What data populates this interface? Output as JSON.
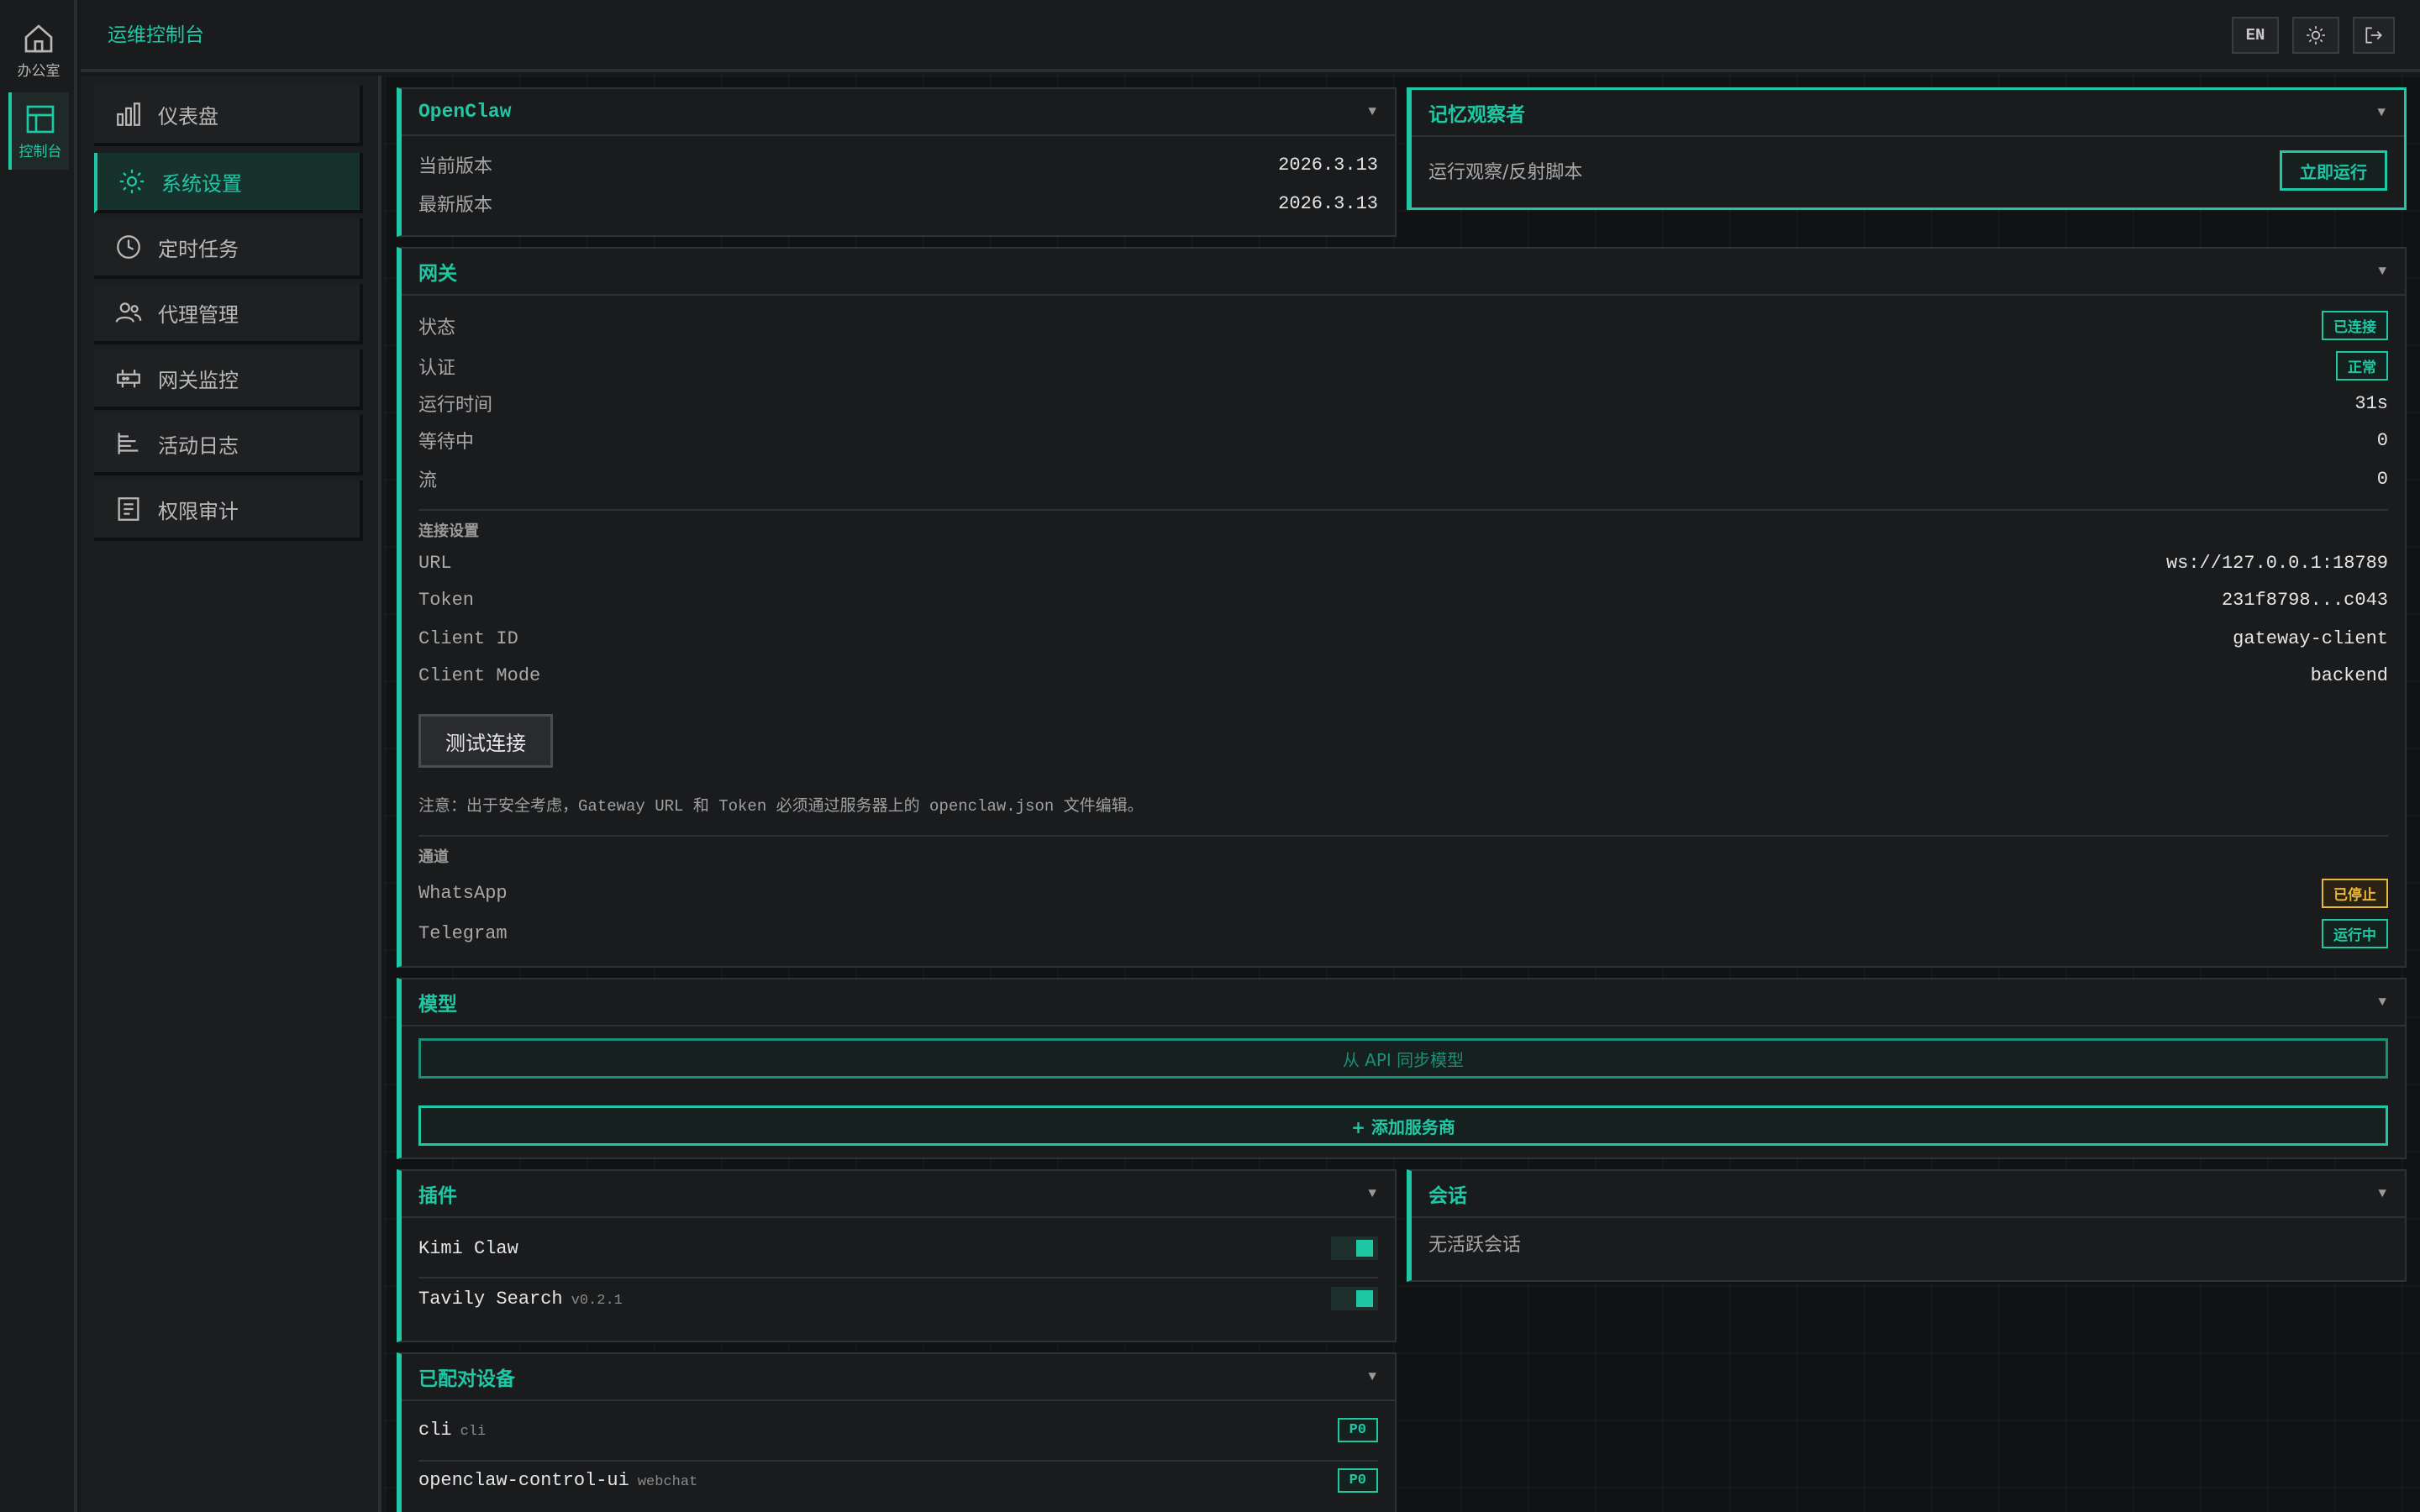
{
  "rail": {
    "office_label": "办公室",
    "console_label": "控制台"
  },
  "topbar": {
    "title": "运维控制台",
    "lang_label": "EN"
  },
  "nav": {
    "items": [
      {
        "label": "仪表盘",
        "icon": "bar-chart-icon"
      },
      {
        "label": "系统设置",
        "icon": "gear-icon",
        "active": true
      },
      {
        "label": "定时任务",
        "icon": "clock-icon"
      },
      {
        "label": "代理管理",
        "icon": "users-icon"
      },
      {
        "label": "网关监控",
        "icon": "router-icon"
      },
      {
        "label": "活动日志",
        "icon": "list-icon"
      },
      {
        "label": "权限审计",
        "icon": "document-icon"
      }
    ]
  },
  "openclaw": {
    "title": "OpenClaw",
    "current_version_label": "当前版本",
    "current_version": "2026.3.13",
    "latest_version_label": "最新版本",
    "latest_version": "2026.3.13"
  },
  "memory": {
    "title": "记忆观察者",
    "script_label": "运行观察/反射脚本",
    "run_button": "立即运行"
  },
  "gateway": {
    "title": "网关",
    "status_label": "状态",
    "status_value": "已连接",
    "auth_label": "认证",
    "auth_value": "正常",
    "uptime_label": "运行时间",
    "uptime_value": "31s",
    "pending_label": "等待中",
    "pending_value": "0",
    "stream_label": "流",
    "stream_value": "0",
    "conn_section": "连接设置",
    "url_label": "URL",
    "url_value": "ws://127.0.0.1:18789",
    "token_label": "Token",
    "token_value": "231f8798...c043",
    "client_id_label": "Client ID",
    "client_id_value": "gateway-client",
    "client_mode_label": "Client Mode",
    "client_mode_value": "backend",
    "test_button": "测试连接",
    "note": "注意：出于安全考虑，Gateway URL 和 Token 必须通过服务器上的 openclaw.json 文件编辑。",
    "channel_section": "通道",
    "whatsapp_label": "WhatsApp",
    "whatsapp_status": "已停止",
    "telegram_label": "Telegram",
    "telegram_status": "运行中"
  },
  "models": {
    "title": "模型",
    "sync_button": "从 API 同步模型",
    "add_button": "+ 添加服务商"
  },
  "plugins": {
    "title": "插件",
    "items": [
      {
        "name": "Kimi Claw",
        "version": "",
        "enabled": true
      },
      {
        "name": "Tavily Search",
        "version": "v0.2.1",
        "enabled": true
      }
    ]
  },
  "sessions": {
    "title": "会话",
    "empty": "无活跃会话"
  },
  "devices": {
    "title": "已配对设备",
    "items": [
      {
        "name": "cli",
        "type": "cli",
        "badge": "P0"
      },
      {
        "name": "openclaw-control-ui",
        "type": "webchat",
        "badge": "P0"
      }
    ]
  },
  "colors": {
    "accent": "#1fc8a4",
    "warn": "#e8b83a",
    "background": "#111214",
    "panel": "#1a1b1d"
  }
}
